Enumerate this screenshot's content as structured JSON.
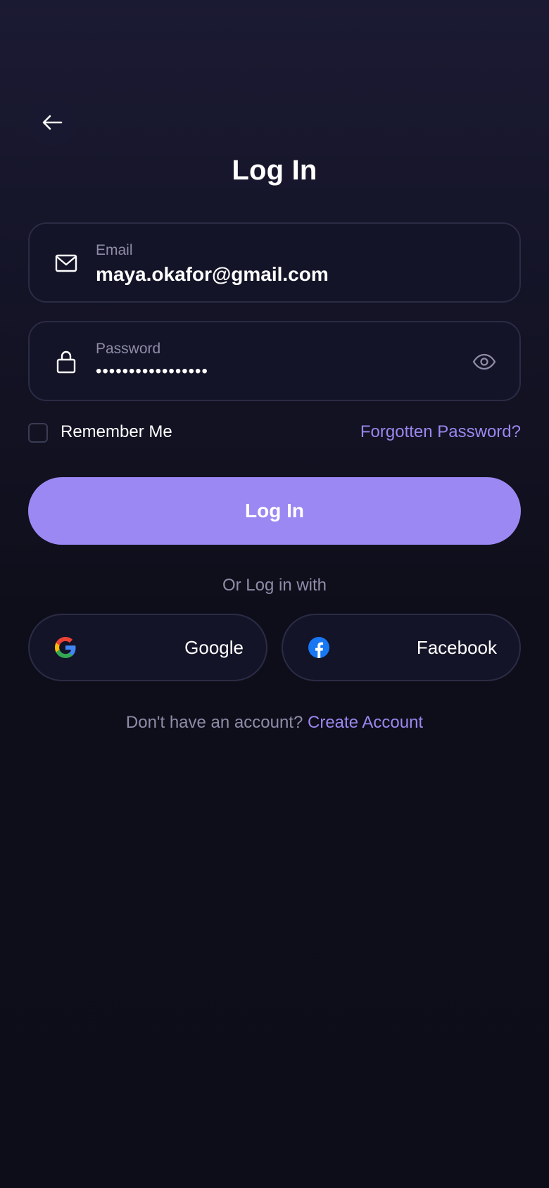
{
  "header": {
    "back_icon": "arrow-left-icon",
    "title": "Log In"
  },
  "email_field": {
    "icon": "mail-icon",
    "label": "Email",
    "value": "maya.okafor@gmail.com"
  },
  "password_field": {
    "icon": "lock-icon",
    "label": "Password",
    "masked_value": "•••••••••••••••••",
    "toggle_icon": "eye-icon"
  },
  "options": {
    "remember_label": "Remember Me",
    "remember_checked": false,
    "forgot_label": "Forgotten Password?"
  },
  "login_button": {
    "label": "Log In"
  },
  "social": {
    "divider_text": "Or Log in with",
    "google_label": "Google",
    "google_icon": "google-icon",
    "facebook_label": "Facebook",
    "facebook_icon": "facebook-icon"
  },
  "footer": {
    "prompt": "Don't have an account?",
    "link": "Create Account"
  },
  "colors": {
    "accent": "#9b88f2",
    "link": "#9a87ef",
    "background": "#0d0d1a",
    "facebook": "#1877f2"
  }
}
